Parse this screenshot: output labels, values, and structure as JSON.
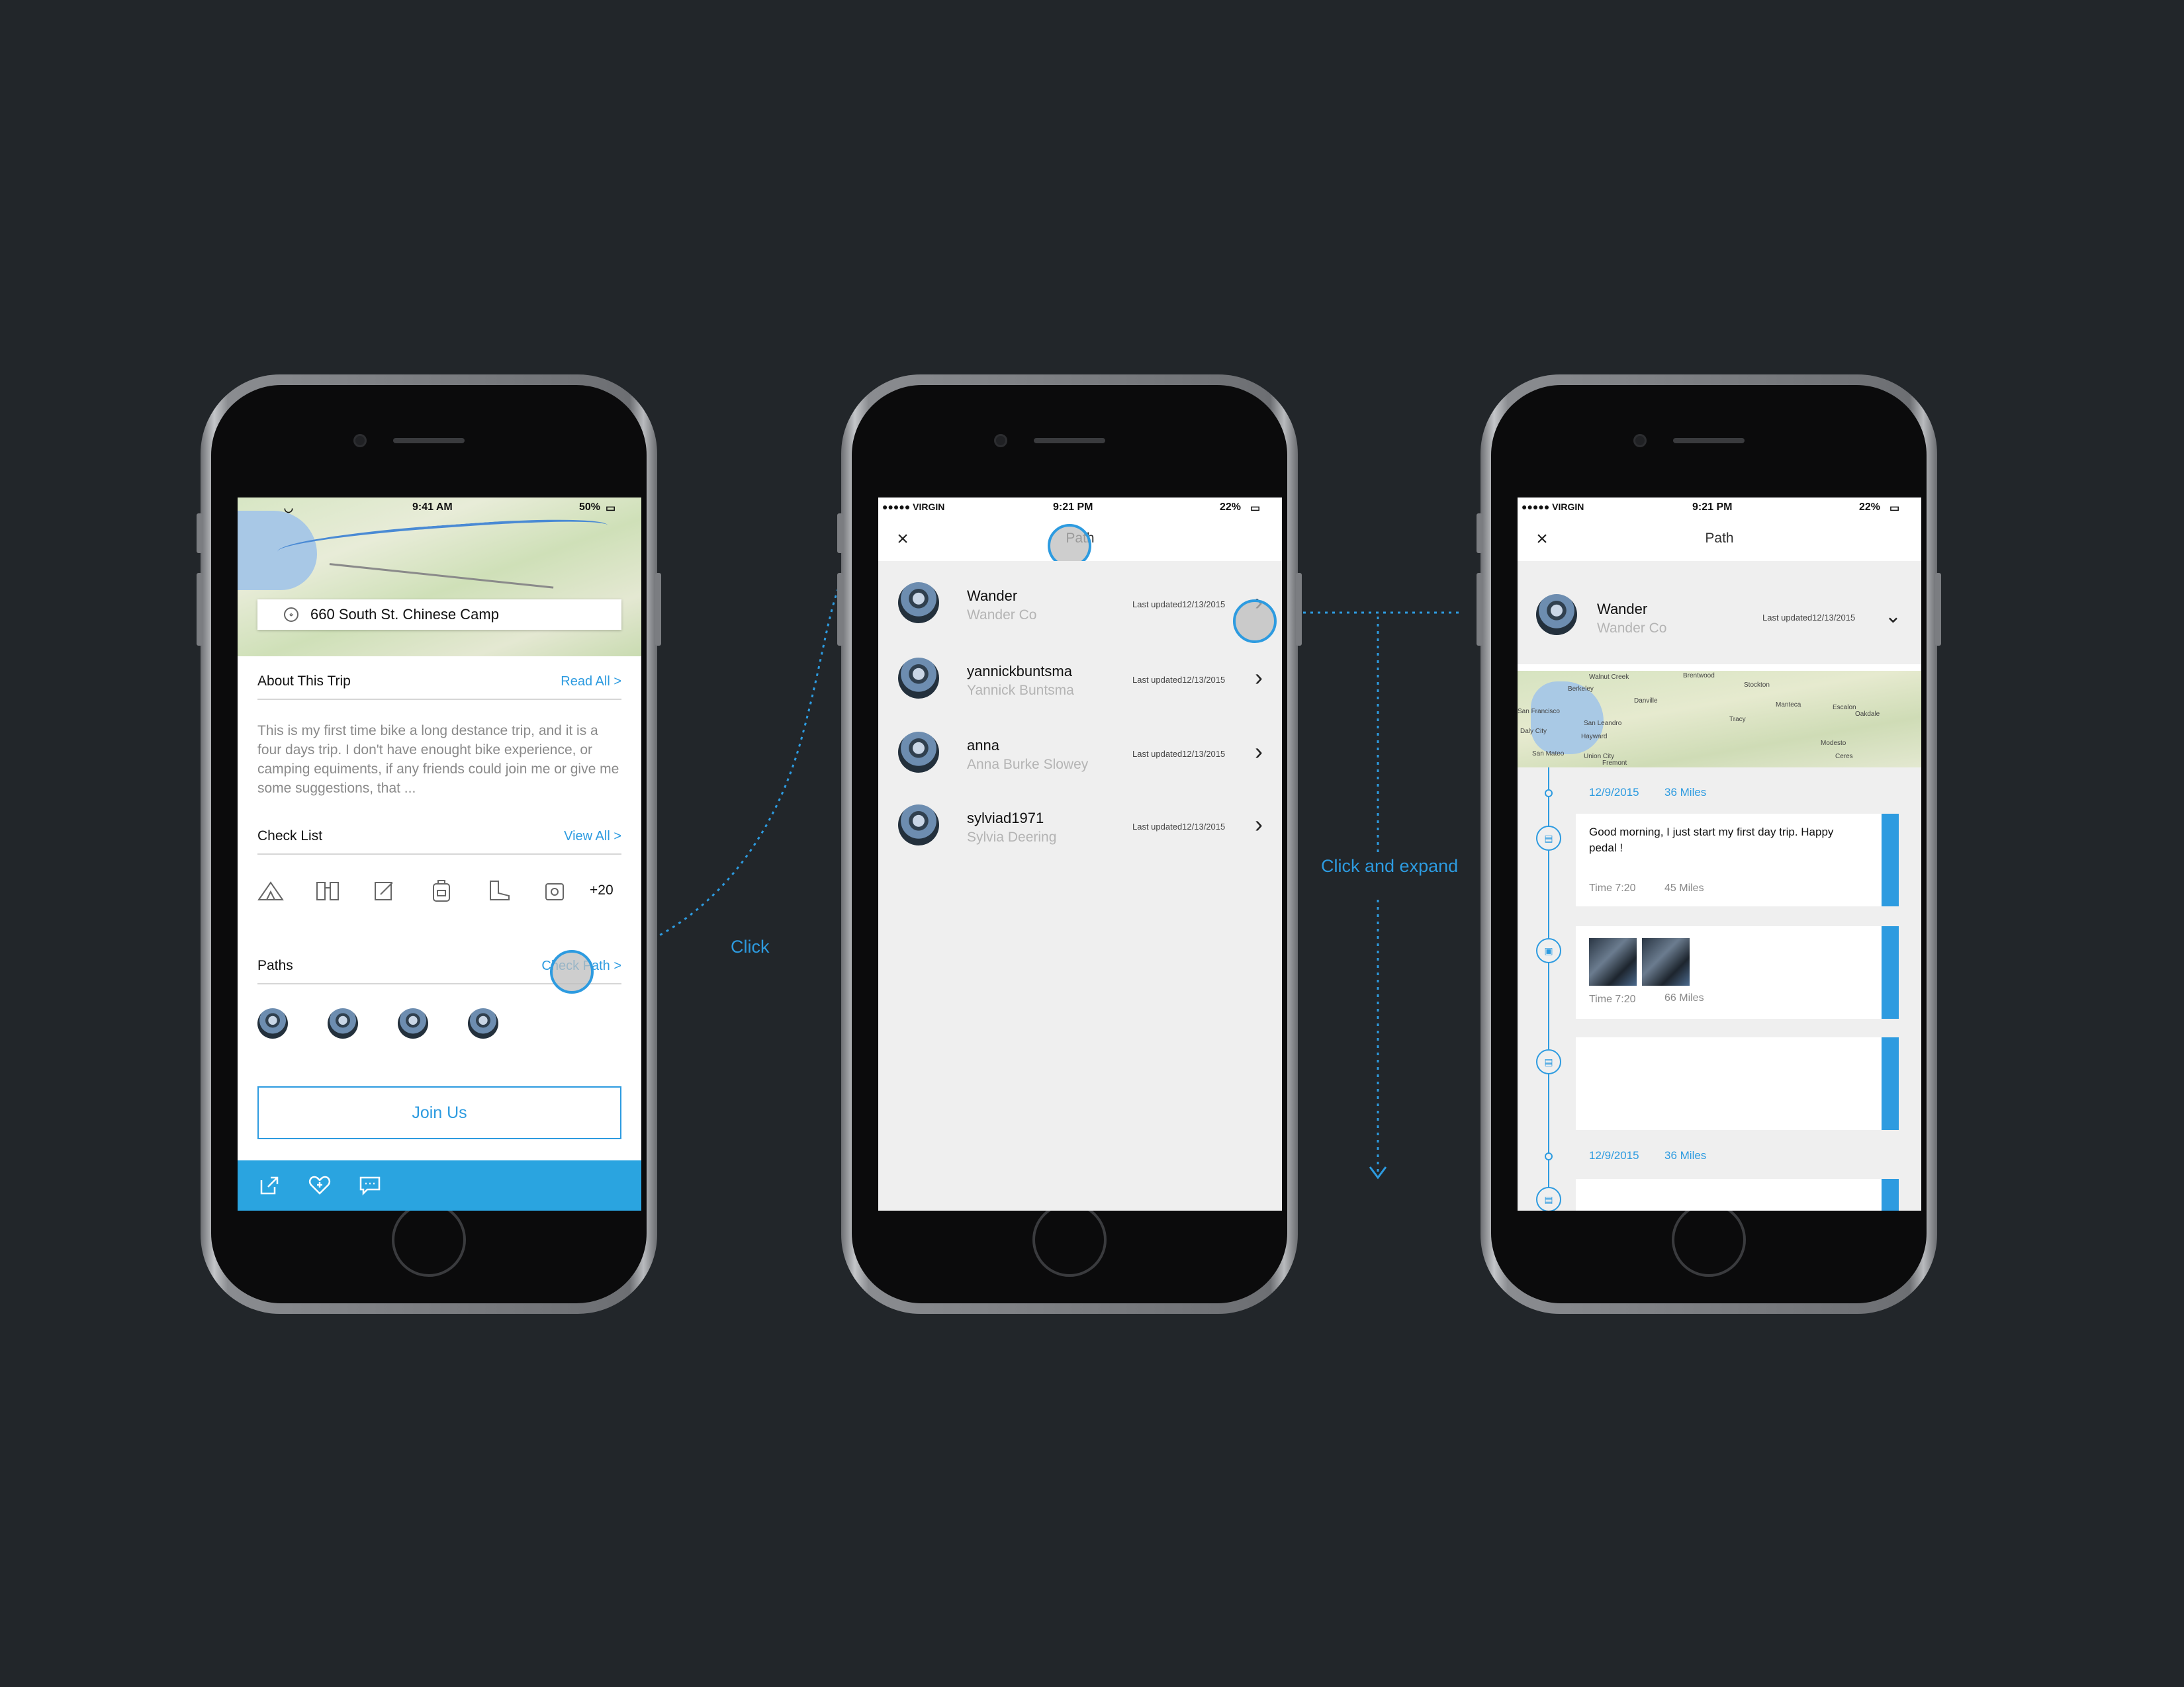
{
  "annotations": {
    "click": "Click",
    "expand": "Click and expand"
  },
  "colors": {
    "accent": "#2d9be0",
    "background": "#22262a",
    "bottom_bar": "#2aa4e0"
  },
  "screen1": {
    "status_time": "9:41 AM",
    "status_battery": "50%",
    "address": "660 South St. Chinese Camp",
    "about": {
      "title": "About This Trip",
      "action": "Read All  >",
      "text": "This is my first time bike a long destance trip, and it is a four days trip. I don't have enought bike experience, or camping equiments, if any friends could join me or give me some suggestions, that ..."
    },
    "checklist": {
      "title": "Check List",
      "action": "View All  >",
      "icons": [
        "tent-icon",
        "binoculars-icon",
        "notepad-icon",
        "backpack-icon",
        "boot-icon",
        "camera-icon"
      ],
      "more": "+20"
    },
    "paths": {
      "title": "Paths",
      "action": "Check Path  >"
    },
    "join_label": "Join Us",
    "bottom_icons": [
      "share-icon",
      "heart-add-icon",
      "comment-icon"
    ]
  },
  "screen2": {
    "carrier": "●●●●● VIRGIN",
    "time": "9:21 PM",
    "battery": "22%",
    "title": "Path",
    "rows": [
      {
        "name": "Wander",
        "sub": "Wander Co",
        "updated": "Last updated12/13/2015"
      },
      {
        "name": "yannickbuntsma",
        "sub": "Yannick Buntsma",
        "updated": "Last updated12/13/2015"
      },
      {
        "name": "anna",
        "sub": "Anna Burke Slowey",
        "updated": "Last updated12/13/2015"
      },
      {
        "name": "sylviad1971",
        "sub": "Sylvia Deering",
        "updated": "Last updated12/13/2015"
      }
    ]
  },
  "screen3": {
    "carrier": "●●●●● VIRGIN",
    "time": "9:21 PM",
    "battery": "22%",
    "title": "Path",
    "name": "Wander",
    "sub": "Wander Co",
    "updated": "Last updated12/13/2015",
    "map_labels": [
      "Walnut Creek",
      "Brentwood",
      "Berkeley",
      "Stockton",
      "San Francisco",
      "Danville",
      "Manteca",
      "San Leandro",
      "Tracy",
      "Daly City",
      "Hayward",
      "Modesto",
      "San Mateo",
      "Union City",
      "Fremont",
      "Escalon",
      "Oakdale",
      "Ceres"
    ],
    "groups": [
      {
        "date": "12/9/2015",
        "miles": "36 Miles"
      },
      {
        "date": "12/9/2015",
        "miles": "36 Miles"
      }
    ],
    "card1": {
      "message": "Good morning, I just start my first day trip. Happy pedal !",
      "time": "Time  7:20",
      "miles": "45 Miles"
    },
    "card2": {
      "time": "Time  7:20",
      "miles": "66 Miles"
    }
  }
}
